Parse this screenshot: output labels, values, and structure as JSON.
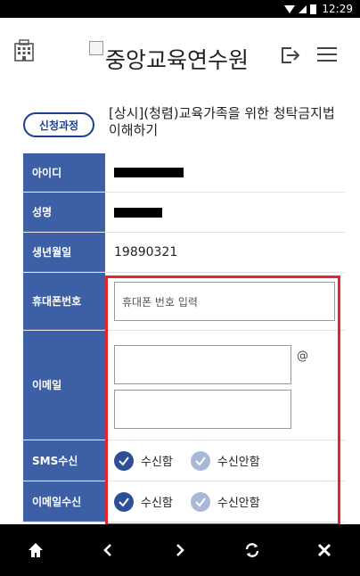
{
  "status_bar": {
    "time": "12:29"
  },
  "header": {
    "site_title": "중앙교육연수원",
    "icons": [
      "building-icon",
      "login-icon",
      "menu-icon"
    ]
  },
  "course": {
    "badge_label": "신청과정",
    "title": "[상시](청렴)교육가족을 위한 청탁금지법 이해하기"
  },
  "form": {
    "id_label": "아이디",
    "name_label": "성명",
    "birth_label": "생년월일",
    "birth_value": "19890321",
    "phone_label": "휴대폰번호",
    "phone_placeholder": "휴대폰 번호 입력",
    "email_label": "이메일",
    "email_at": "@",
    "sms_label": "SMS수신",
    "sms_options": {
      "yes": "수신함",
      "no": "수신안함",
      "selected": "yes"
    },
    "mail_recv_label": "이메일수신",
    "mail_options": {
      "yes": "수신함",
      "no": "수신안함",
      "selected": "yes"
    }
  },
  "colors": {
    "label_bg": "#3d5fa6",
    "accent": "#1b3f8f",
    "highlight": "#e8232a"
  },
  "bottom_nav": {
    "home": "home-icon",
    "back": "back-icon",
    "forward": "forward-icon",
    "refresh": "refresh-icon",
    "close": "close-icon"
  }
}
